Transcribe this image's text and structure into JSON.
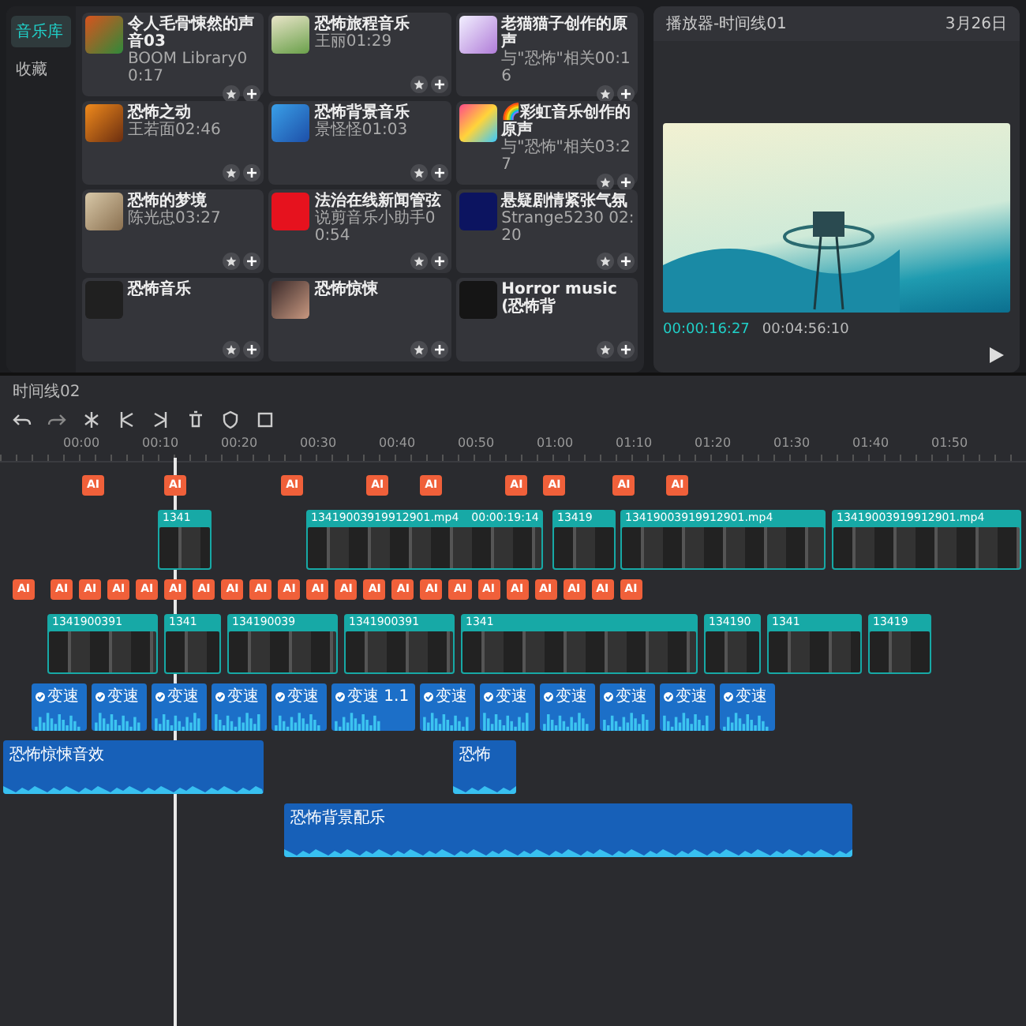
{
  "library": {
    "sidebar": [
      {
        "label": "音乐库",
        "selected": true
      },
      {
        "label": "收藏",
        "selected": false
      }
    ],
    "cards": [
      {
        "title": "令人毛骨悚然的声音03",
        "meta": "BOOM Library00:17"
      },
      {
        "title": "恐怖旅程音乐",
        "meta": "王丽01:29"
      },
      {
        "title": "老猫猫子创作的原声",
        "meta": "与\"恐怖\"相关00:16"
      },
      {
        "title": "恐怖之动",
        "meta": "王若面02:46"
      },
      {
        "title": "恐怖背景音乐",
        "meta": "景怪怪01:03"
      },
      {
        "title": "🌈彩虹音乐创作的原声",
        "meta": "与\"恐怖\"相关03:27"
      },
      {
        "title": "恐怖的梦境",
        "meta": "陈光忠03:27"
      },
      {
        "title": "法治在线新闻管弦",
        "meta": "说剪音乐小助手00:54"
      },
      {
        "title": "悬疑剧情紧张气氛",
        "meta": "Strange5230 02:20"
      },
      {
        "title": "恐怖音乐"
      },
      {
        "title": "恐怖惊悚"
      },
      {
        "title": "Horror music (恐怖背"
      }
    ]
  },
  "player": {
    "title": "播放器-时间线01",
    "date": "3月26日",
    "current_time": "00:00:16:27",
    "total_time": "00:04:56:10"
  },
  "timeline": {
    "title": "时间线02",
    "ruler": [
      "00:00",
      "00:10",
      "00:20",
      "00:30",
      "00:40",
      "00:50",
      "01:00",
      "01:10",
      "01:20",
      "01:30",
      "01:40",
      "01:50"
    ],
    "tracks": [
      {
        "kind": "text",
        "clips": [
          {
            "label": "AI"
          },
          {
            "label": "AI"
          },
          {
            "label": "AI"
          },
          {
            "label": "AI"
          },
          {
            "label": "AI"
          },
          {
            "label": "AI"
          },
          {
            "label": "AI"
          },
          {
            "label": "AI"
          },
          {
            "label": "AI"
          }
        ]
      },
      {
        "kind": "video",
        "clips": [
          {
            "label": "1341"
          },
          {
            "label": "13419003919912901.mp4",
            "duration": "00:00:19:14"
          },
          {
            "label": "13419"
          },
          {
            "label": "13419003919912901.mp4"
          },
          {
            "label": "13419003919912901.mp4"
          }
        ]
      },
      {
        "kind": "text",
        "clips": [
          {
            "label": "AI"
          },
          {
            "label": "AI"
          },
          {
            "label": "AI"
          },
          {
            "label": "AI"
          },
          {
            "label": "AI"
          },
          {
            "label": "AI"
          },
          {
            "label": "AI"
          },
          {
            "label": "AI"
          },
          {
            "label": "AI"
          },
          {
            "label": "AI"
          },
          {
            "label": "AI"
          },
          {
            "label": "AI"
          },
          {
            "label": "AI"
          },
          {
            "label": "AI"
          },
          {
            "label": "AI"
          },
          {
            "label": "AI"
          },
          {
            "label": "AI"
          },
          {
            "label": "AI"
          },
          {
            "label": "AI"
          },
          {
            "label": "AI"
          },
          {
            "label": "AI"
          },
          {
            "label": "AI"
          }
        ]
      },
      {
        "kind": "video",
        "clips": [
          {
            "label": "1341900391"
          },
          {
            "label": "1341"
          },
          {
            "label": "134190039"
          },
          {
            "label": "1341900391"
          },
          {
            "label": "1341"
          },
          {
            "label": "134190"
          },
          {
            "label": "1341"
          },
          {
            "label": "13419"
          }
        ]
      },
      {
        "kind": "audio",
        "clips": [
          {
            "label": "变速"
          },
          {
            "label": "变速"
          },
          {
            "label": "变速"
          },
          {
            "label": "变速"
          },
          {
            "label": "变速"
          },
          {
            "label": "变速 1.1"
          },
          {
            "label": "变速"
          },
          {
            "label": "变速"
          },
          {
            "label": "变速"
          },
          {
            "label": "变速"
          },
          {
            "label": "变速"
          },
          {
            "label": "变速"
          }
        ]
      },
      {
        "kind": "music",
        "clips": [
          {
            "label": "恐怖惊悚音效"
          },
          {
            "label": "恐怖"
          }
        ]
      },
      {
        "kind": "music",
        "clips": [
          {
            "label": "恐怖背景配乐"
          }
        ]
      }
    ]
  }
}
